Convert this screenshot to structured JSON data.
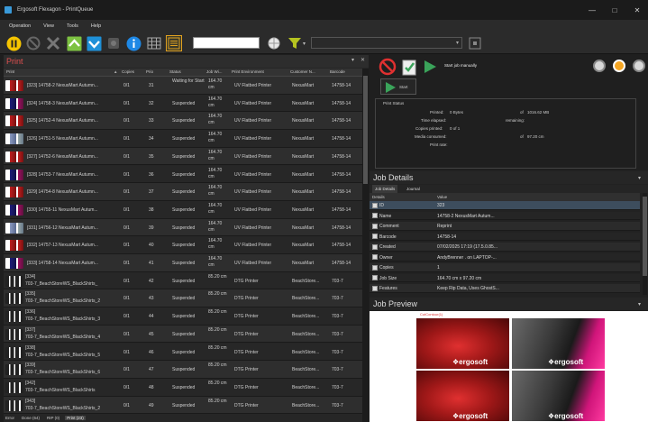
{
  "window": {
    "title": "Ergosoft Flexagon - PrintQueue"
  },
  "menu": {
    "items": [
      "Operation",
      "View",
      "Tools",
      "Help"
    ]
  },
  "print_panel": {
    "title": "Print",
    "columns": [
      "Print",
      "Copies",
      "Prio",
      "Status",
      "Job Wi...",
      "Print Environment",
      "Customer N...",
      "Barcode"
    ],
    "rows": [
      {
        "name": "[323] 14758-2 NexusMart Autumn...",
        "copies": "0/1",
        "prio": "31",
        "status": "Waiting for Start",
        "width": "164.70 cm",
        "env": "UV Flatbed Printer",
        "customer": "NexusMart",
        "barcode": "14758-14"
      },
      {
        "name": "[324] 14758-3 NexusMart Autumn...",
        "copies": "0/1",
        "prio": "32",
        "status": "Suspended",
        "width": "164.70 cm",
        "env": "UV Flatbed Printer",
        "customer": "NexusMart",
        "barcode": "14758-14"
      },
      {
        "name": "[325] 14752-4 NexusMart Autumn...",
        "copies": "0/1",
        "prio": "33",
        "status": "Suspended",
        "width": "164.70 cm",
        "env": "UV Flatbed Printer",
        "customer": "NexusMart",
        "barcode": "14758-14"
      },
      {
        "name": "[326] 14751-5 NexusMart Autumn...",
        "copies": "0/1",
        "prio": "34",
        "status": "Suspended",
        "width": "164.70 cm",
        "env": "UV Flatbed Printer",
        "customer": "NexusMart",
        "barcode": "14758-14"
      },
      {
        "name": "[327] 14752-6 NexusMart Autumn...",
        "copies": "0/1",
        "prio": "35",
        "status": "Suspended",
        "width": "164.70 cm",
        "env": "UV Flatbed Printer",
        "customer": "NexusMart",
        "barcode": "14758-14"
      },
      {
        "name": "[328] 14753-7 NexusMart Autumn...",
        "copies": "0/1",
        "prio": "36",
        "status": "Suspended",
        "width": "164.70 cm",
        "env": "UV Flatbed Printer",
        "customer": "NexusMart",
        "barcode": "14758-14"
      },
      {
        "name": "[329] 14754-8 NexusMart Autumn...",
        "copies": "0/1",
        "prio": "37",
        "status": "Suspended",
        "width": "164.70 cm",
        "env": "UV Flatbed Printer",
        "customer": "NexusMart",
        "barcode": "14758-14"
      },
      {
        "name": "[330] 14755-11 NexusMart Autum...",
        "copies": "0/1",
        "prio": "38",
        "status": "Suspended",
        "width": "164.70 cm",
        "env": "UV Flatbed Printer",
        "customer": "NexusMart",
        "barcode": "14758-14"
      },
      {
        "name": "[331] 14756-12 NexusMart Autum...",
        "copies": "0/1",
        "prio": "39",
        "status": "Suspended",
        "width": "164.70 cm",
        "env": "UV Flatbed Printer",
        "customer": "NexusMart",
        "barcode": "14758-14"
      },
      {
        "name": "[332] 14757-13 NexusMart Autum...",
        "copies": "0/1",
        "prio": "40",
        "status": "Suspended",
        "width": "164.70 cm",
        "env": "UV Flatbed Printer",
        "customer": "NexusMart",
        "barcode": "14758-14"
      },
      {
        "name": "[333] 14758-14 NexusMart Autum...",
        "copies": "0/1",
        "prio": "41",
        "status": "Suspended",
        "width": "164.70 cm",
        "env": "UV Flatbed Printer",
        "customer": "NexusMart",
        "barcode": "14758-14"
      },
      {
        "name": "[334]",
        "name2": "703-7_BeachStoreWS_BlackShirts_",
        "copies": "0/1",
        "prio": "42",
        "status": "Suspended",
        "width": "85.20 cm",
        "env": "DTG Printer",
        "customer": "BeachStore...",
        "barcode": "703-7"
      },
      {
        "name": "[335]",
        "name2": "703-7_BeachStoreWS_BlackShirts_2",
        "copies": "0/1",
        "prio": "43",
        "status": "Suspended",
        "width": "85.20 cm",
        "env": "DTG Printer",
        "customer": "BeachStore...",
        "barcode": "703-7"
      },
      {
        "name": "[336]",
        "name2": "703-7_BeachStoreWS_BlackShirts_3",
        "copies": "0/1",
        "prio": "44",
        "status": "Suspended",
        "width": "85.20 cm",
        "env": "DTG Printer",
        "customer": "BeachStore...",
        "barcode": "703-7"
      },
      {
        "name": "[337]",
        "name2": "703-7_BeachStoreWS_BlackShirts_4",
        "copies": "0/1",
        "prio": "45",
        "status": "Suspended",
        "width": "85.20 cm",
        "env": "DTG Printer",
        "customer": "BeachStore...",
        "barcode": "703-7"
      },
      {
        "name": "[338]",
        "name2": "703-7_BeachStoreWS_BlackShirts_5",
        "copies": "0/1",
        "prio": "46",
        "status": "Suspended",
        "width": "85.20 cm",
        "env": "DTG Printer",
        "customer": "BeachStore...",
        "barcode": "703-7"
      },
      {
        "name": "[339]",
        "name2": "703-7_BeachStoreWS_BlackShirts_6",
        "copies": "0/1",
        "prio": "47",
        "status": "Suspended",
        "width": "85.20 cm",
        "env": "DTG Printer",
        "customer": "BeachStore...",
        "barcode": "703-7"
      },
      {
        "name": "[342]",
        "name2": "703-7_BeachStoreWS_BlackShirts",
        "copies": "0/1",
        "prio": "48",
        "status": "Suspended",
        "width": "85.20 cm",
        "env": "DTG Printer",
        "customer": "BeachStore...",
        "barcode": "703-7"
      },
      {
        "name": "[343]",
        "name2": "703-7_BeachStoreWS_BlackShirts_2",
        "copies": "0/1",
        "prio": "49",
        "status": "Suspended",
        "width": "85.20 cm",
        "env": "DTG Printer",
        "customer": "BeachStore...",
        "barcode": "703-7"
      }
    ]
  },
  "statusbar": {
    "items": [
      "Error",
      "Done (64)",
      "RIP (0)",
      "Print (23)"
    ]
  },
  "control": {
    "start_manual": "Start job manually",
    "start_label": "Start",
    "print_status_title": "Print Status",
    "printed_label": "Printed:",
    "printed_value": "0 Bytes",
    "printed_of": "of",
    "printed_total": "1016.62 MB",
    "elapsed_label": "Time elapsed:",
    "remaining_label": "remaining:",
    "copies_label": "Copies printed:",
    "copies_value": "0 of 1",
    "media_label": "Media consumed:",
    "media_of": "of",
    "media_total": "97.20 cm",
    "rate_label": "Print rate:"
  },
  "job_details": {
    "title": "Job Details",
    "tabs": [
      "Job Details",
      "Journal"
    ],
    "columns": [
      "Details",
      "Value"
    ],
    "rows": [
      {
        "label": "ID",
        "value": "323"
      },
      {
        "label": "Name",
        "value": "14758-2 NexusMart Autum..."
      },
      {
        "label": "Comment",
        "value": "Reprint"
      },
      {
        "label": "Barcode",
        "value": "14758-14"
      },
      {
        "label": "Created",
        "value": "07/02/2025 17:19 (17.5.0.85..."
      },
      {
        "label": "Owner",
        "value": "AndyBrenner . on LAPTOP-..."
      },
      {
        "label": "Copies",
        "value": "1"
      },
      {
        "label": "Job Size",
        "value": "164.70 cm x 97.20 cm"
      },
      {
        "label": "Features",
        "value": "Keep Rip Data, Uses GhostS..."
      }
    ]
  },
  "job_preview": {
    "title": "Job Preview",
    "logo": "ergosoft",
    "cut_label": "CutContour(1)"
  },
  "colors": {
    "accent": "#e05050",
    "pause": "#f5c400",
    "info": "#1e88e5",
    "play": "#3aa35a",
    "up": "#7dc242"
  }
}
